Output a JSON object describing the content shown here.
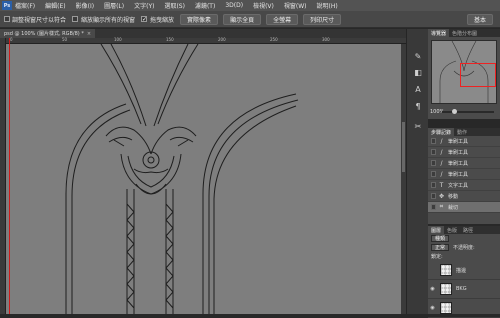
{
  "menubar": {
    "logo": "Ps",
    "items": [
      "檔案(F)",
      "編輯(E)",
      "影像(I)",
      "圖層(L)",
      "文字(Y)",
      "選取(S)",
      "濾鏡(T)",
      "3D(D)",
      "檢視(V)",
      "視窗(W)",
      "說明(H)"
    ]
  },
  "optbar": {
    "snap_label": "調整視窗尺寸以符合",
    "zoom_all_label": "縮放顯示所有的視窗",
    "scrubby_label": "拖曳縮放",
    "btn_actual": "實際像素",
    "btn_fit": "顯示全頁",
    "btn_fill": "全螢幕",
    "btn_print": "列印尺寸",
    "workspace": "基本"
  },
  "doc_tab": {
    "title": "psd @ 100% (圖片樣式, RGB/8) *",
    "close": "×"
  },
  "ruler": {
    "marks": [
      "0",
      "50",
      "100",
      "150",
      "200",
      "250",
      "300"
    ]
  },
  "panels": {
    "navigator_tabs": [
      "導覽器",
      "色階分布圖"
    ],
    "zoom": "100%",
    "history_tabs": [
      "步驟記錄",
      "動作"
    ],
    "history_items": [
      {
        "label": "筆刷工具",
        "icon": "brush"
      },
      {
        "label": "筆刷工具",
        "icon": "brush"
      },
      {
        "label": "筆刷工具",
        "icon": "brush"
      },
      {
        "label": "筆刷工具",
        "icon": "brush"
      },
      {
        "label": "文字工具",
        "icon": "text"
      },
      {
        "label": "移動",
        "icon": "move"
      },
      {
        "label": "裁切",
        "icon": "crop"
      }
    ],
    "layers_tabs": [
      "圖層",
      "色版",
      "路徑"
    ],
    "kind": "種類",
    "blend_mode": "正常",
    "opacity_label": "不透明度:",
    "lock_label": "鎖定:",
    "layers": [
      {
        "name": "描邊"
      },
      {
        "name": "BKG"
      },
      {
        "name": ""
      }
    ]
  },
  "colors": {
    "canvas": "#7e7e7e",
    "guide": "#d21a1a",
    "nav_view": "#e22222"
  }
}
